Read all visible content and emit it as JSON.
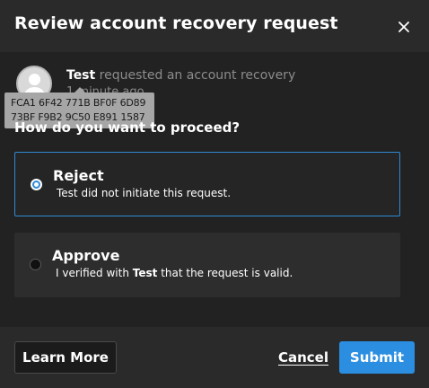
{
  "dialog": {
    "title": "Review account recovery request",
    "close_icon": "close-icon"
  },
  "request": {
    "user_name": "Test",
    "message": " requested an account recovery",
    "time": "1 minute ago",
    "fingerprint_line1": "FCA1 6F42 771B BF0F 6D89",
    "fingerprint_line2": "73BF F9B2 9C50 E891 1587"
  },
  "question": "How do you want to proceed?",
  "options": [
    {
      "label": "Reject",
      "description": "Test did not initiate this request.",
      "selected": true
    },
    {
      "label": "Approve",
      "description_prefix": "I verified with ",
      "description_bold": "Test",
      "description_suffix": " that the request is valid.",
      "selected": false
    }
  ],
  "footer": {
    "learn_more": "Learn More",
    "cancel": "Cancel",
    "submit": "Submit"
  },
  "colors": {
    "accent": "#2b8ee0",
    "background": "#222222",
    "header": "#2a2a2a"
  }
}
